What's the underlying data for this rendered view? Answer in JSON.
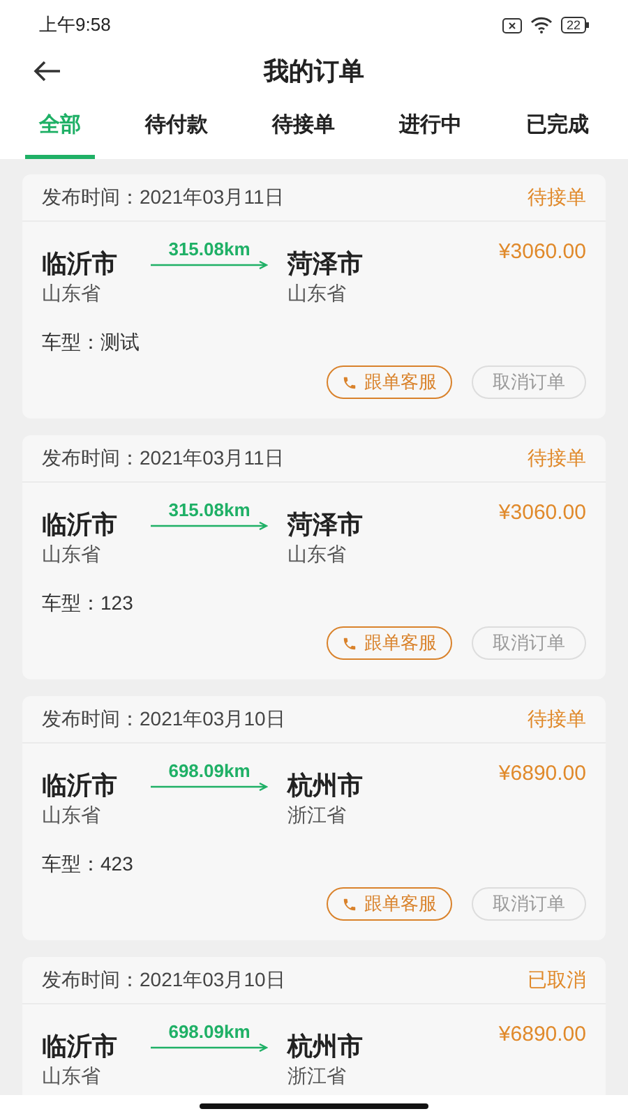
{
  "status_bar": {
    "time": "上午9:58",
    "battery": "22"
  },
  "header": {
    "title": "我的订单"
  },
  "tabs": [
    {
      "label": "全部",
      "selected": true
    },
    {
      "label": "待付款",
      "selected": false
    },
    {
      "label": "待接单",
      "selected": false
    },
    {
      "label": "进行中",
      "selected": false
    },
    {
      "label": "已完成",
      "selected": false
    }
  ],
  "orders": [
    {
      "published": "发布时间：2021年03月11日",
      "status": "待接单",
      "from_city": "临沂市",
      "from_province": "山东省",
      "distance": "315.08km",
      "to_city": "菏泽市",
      "to_province": "山东省",
      "price": "¥3060.00",
      "vehicle": "车型：测试",
      "buttons": [
        "跟单客服",
        "取消订单"
      ]
    },
    {
      "published": "发布时间：2021年03月11日",
      "status": "待接单",
      "from_city": "临沂市",
      "from_province": "山东省",
      "distance": "315.08km",
      "to_city": "菏泽市",
      "to_province": "山东省",
      "price": "¥3060.00",
      "vehicle": "车型：123",
      "buttons": [
        "跟单客服",
        "取消订单"
      ]
    },
    {
      "published": "发布时间：2021年03月10日",
      "status": "待接单",
      "from_city": "临沂市",
      "from_province": "山东省",
      "distance": "698.09km",
      "to_city": "杭州市",
      "to_province": "浙江省",
      "price": "¥6890.00",
      "vehicle": "车型：423",
      "buttons": [
        "跟单客服",
        "取消订单"
      ]
    },
    {
      "published": "发布时间：2021年03月10日",
      "status": "已取消",
      "from_city": "临沂市",
      "from_province": "山东省",
      "distance": "698.09km",
      "to_city": "杭州市",
      "to_province": "浙江省",
      "price": "¥6890.00"
    }
  ]
}
